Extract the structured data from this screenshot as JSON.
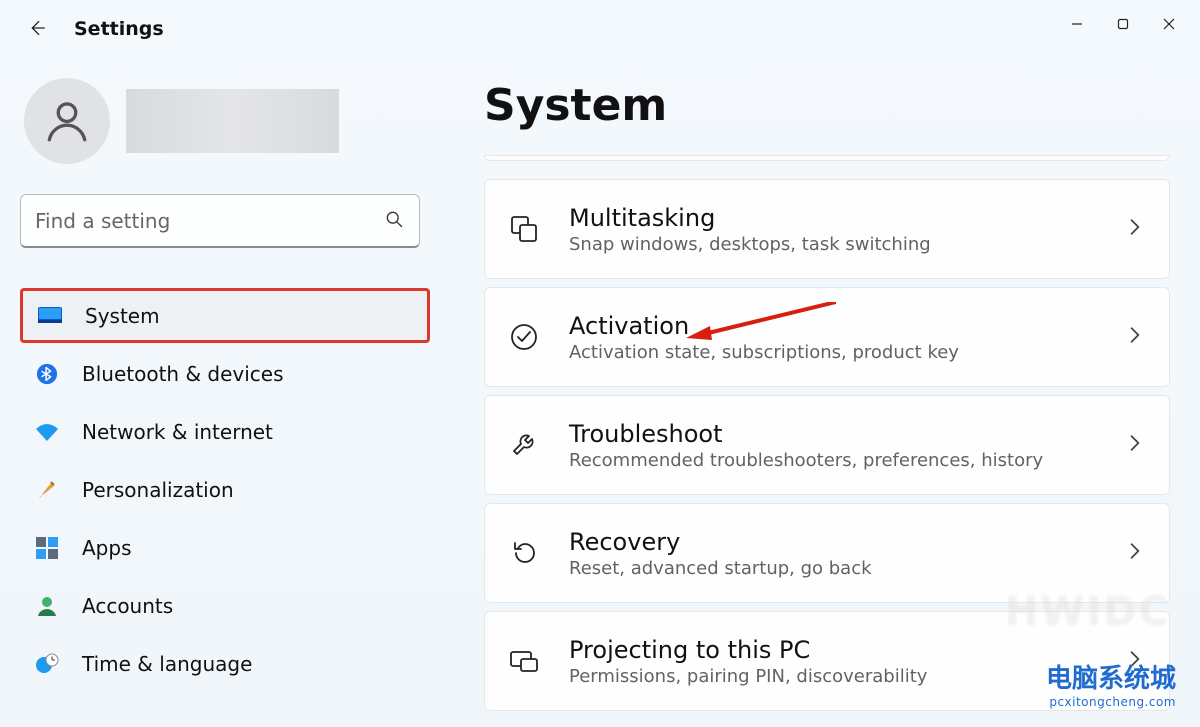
{
  "app": {
    "title": "Settings"
  },
  "search": {
    "placeholder": "Find a setting"
  },
  "nav": {
    "items": [
      {
        "label": "System"
      },
      {
        "label": "Bluetooth & devices"
      },
      {
        "label": "Network & internet"
      },
      {
        "label": "Personalization"
      },
      {
        "label": "Apps"
      },
      {
        "label": "Accounts"
      },
      {
        "label": "Time & language"
      }
    ]
  },
  "main": {
    "title": "System",
    "cards": [
      {
        "title": "Multitasking",
        "desc": "Snap windows, desktops, task switching"
      },
      {
        "title": "Activation",
        "desc": "Activation state, subscriptions, product key"
      },
      {
        "title": "Troubleshoot",
        "desc": "Recommended troubleshooters, preferences, history"
      },
      {
        "title": "Recovery",
        "desc": "Reset, advanced startup, go back"
      },
      {
        "title": "Projecting to this PC",
        "desc": "Permissions, pairing PIN, discoverability"
      }
    ]
  },
  "watermark": {
    "hwidc": "HWIDC",
    "cn": "电脑系统城",
    "cnurl": "pcxitongcheng.com"
  }
}
